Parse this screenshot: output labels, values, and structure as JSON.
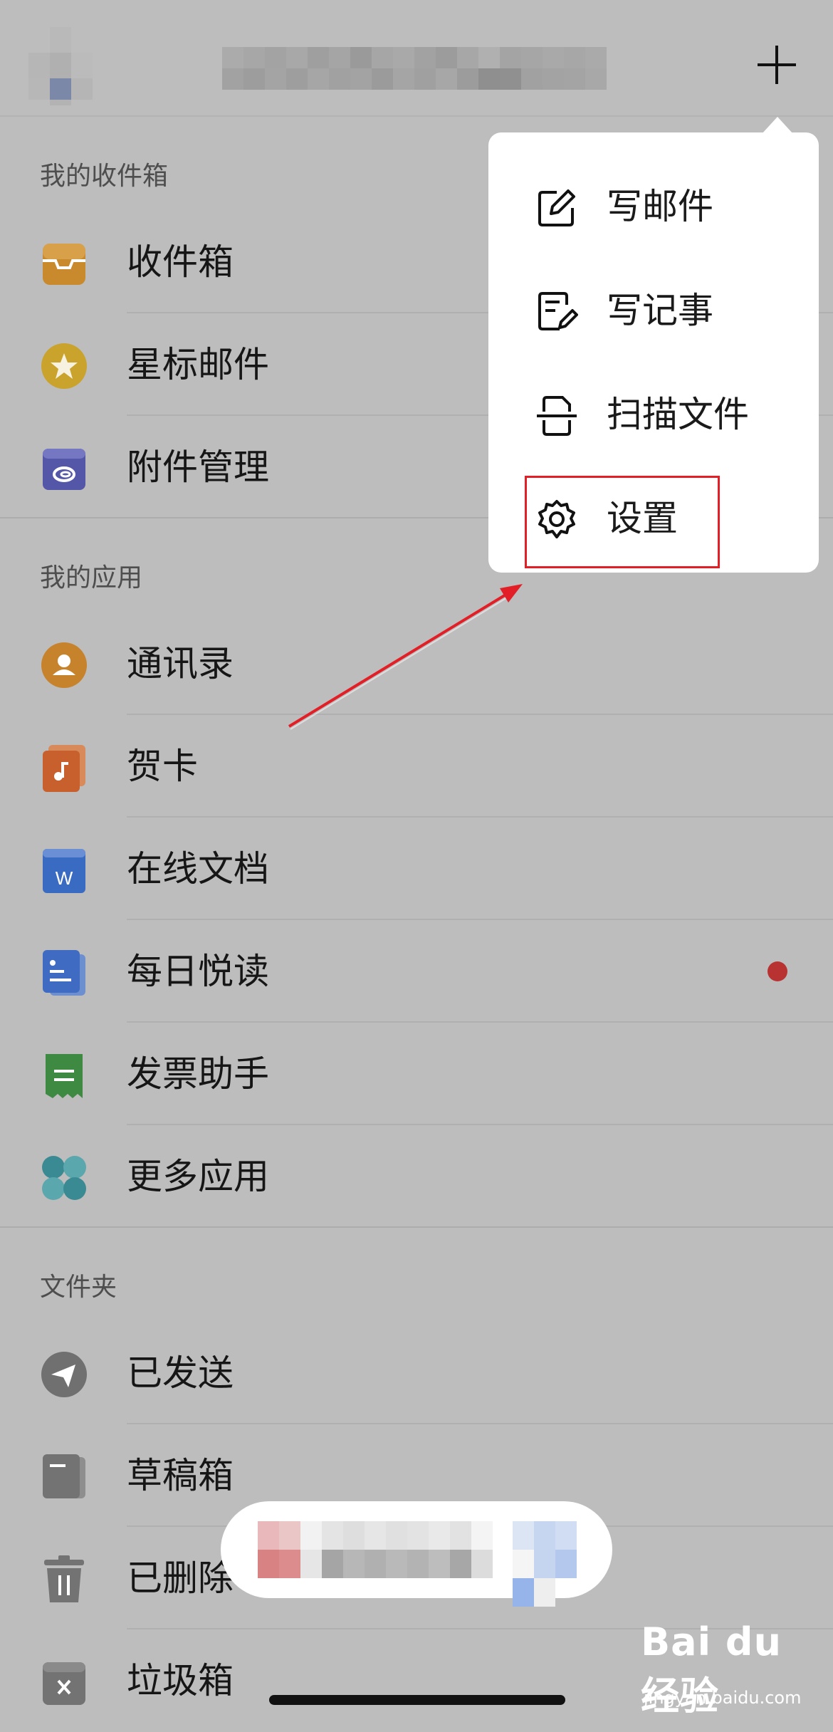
{
  "sections": {
    "my_inbox": "我的收件箱",
    "my_apps": "我的应用",
    "folders": "文件夹"
  },
  "inbox_items": [
    {
      "label": "收件箱",
      "icon": "inbox-tray-icon"
    },
    {
      "label": "星标邮件",
      "icon": "star-icon"
    },
    {
      "label": "附件管理",
      "icon": "attachment-icon"
    }
  ],
  "app_items": [
    {
      "label": "通讯录",
      "icon": "contacts-icon"
    },
    {
      "label": "贺卡",
      "icon": "greeting-card-icon"
    },
    {
      "label": "在线文档",
      "icon": "word-doc-icon"
    },
    {
      "label": "每日悦读",
      "icon": "daily-reading-icon",
      "has_badge": true
    },
    {
      "label": "发票助手",
      "icon": "invoice-icon"
    },
    {
      "label": "更多应用",
      "icon": "more-apps-icon"
    }
  ],
  "folder_items": [
    {
      "label": "已发送",
      "icon": "sent-plane-icon"
    },
    {
      "label": "草稿箱",
      "icon": "draft-icon"
    },
    {
      "label": "已删除",
      "icon": "trash-icon"
    },
    {
      "label": "垃圾箱",
      "icon": "spam-box-icon"
    }
  ],
  "menu": {
    "items": [
      {
        "label": "写邮件",
        "icon": "compose-icon"
      },
      {
        "label": "写记事",
        "icon": "note-icon"
      },
      {
        "label": "扫描文件",
        "icon": "scan-icon"
      },
      {
        "label": "设置",
        "icon": "gear-icon"
      }
    ]
  },
  "watermark": {
    "logo": "Bai du 经验",
    "url": "jingyan.baidu.com"
  },
  "colors": {
    "inbox": "#c98a2e",
    "star": "#c9a32c",
    "attachment": "#5456a8",
    "contacts": "#c7832c",
    "card": "#c7602c",
    "word": "#3a6bc2",
    "reading": "#3f6cc2",
    "invoice": "#3f8a43",
    "highlight": "#e21f26"
  }
}
